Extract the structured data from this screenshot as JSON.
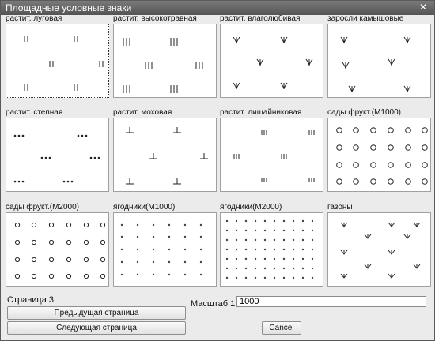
{
  "window": {
    "title": "Площадные условные знаки",
    "close_label": "✕"
  },
  "cells": [
    {
      "label": "растит. луговая",
      "symbol": "ii",
      "selected": true
    },
    {
      "label": "растит. высокотравная",
      "symbol": "iii"
    },
    {
      "label": "растит. влаголюбивая",
      "symbol": "wet"
    },
    {
      "label": "заросли камышовые",
      "symbol": "reed"
    },
    {
      "label": "растит. степная",
      "symbol": "dots3"
    },
    {
      "label": "растит. моховая",
      "symbol": "moss"
    },
    {
      "label": "растит. лишайниковая",
      "symbol": "lichen"
    },
    {
      "label": "сады фрукт.(М1000)",
      "symbol": "circles-big"
    },
    {
      "label": "сады фрукт.(М2000)",
      "symbol": "circles-small"
    },
    {
      "label": "ягодники(М1000)",
      "symbol": "dot-grid"
    },
    {
      "label": "ягодники(М2000)",
      "symbol": "dot-grid-dense"
    },
    {
      "label": "газоны",
      "symbol": "lawn"
    }
  ],
  "footer": {
    "page_label": "Страница 3",
    "prev_button": "Предыдущая страница",
    "next_button": "Следующая страница",
    "scale_label": "Масштаб 1:",
    "scale_value": "1000",
    "cancel_button": "Cancel"
  }
}
